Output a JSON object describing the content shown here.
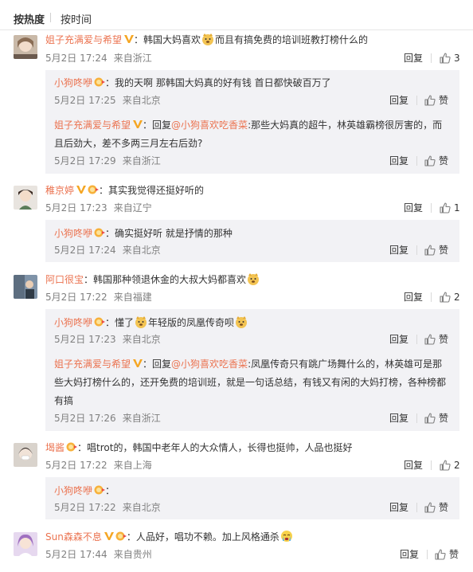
{
  "sort": {
    "hot": "按热度",
    "time": "按时间"
  },
  "actions": {
    "reply": "回复",
    "like": "赞"
  },
  "comments": [
    {
      "user": "姐子充满爱与希望",
      "text_a": "韩国大妈喜欢",
      "text_b": "而且有搞免费的培训班教打榜什么的",
      "date": "5月2日",
      "time": "17:24",
      "from": "来自浙江",
      "likes": "3",
      "replies": [
        {
          "user": "小狗咚咿",
          "text": "我的天啊  那韩国大妈真的好有钱  首日都快破百万了",
          "date": "5月2日",
          "time": "17:25",
          "from": "来自北京"
        },
        {
          "user": "姐子充满爱与希望",
          "prefix": "回复",
          "mention": "@小狗喜欢吃香菜",
          "text1": "那些大妈真的超牛，林英雄霸榜很厉害的，而",
          "text2": "且后劲大，差不多两三月左右后劲?",
          "date": "5月2日",
          "time": "17:29",
          "from": "来自浙江"
        }
      ]
    },
    {
      "user": "稚京婷",
      "text": "其实我觉得还挺好听的",
      "date": "5月2日",
      "time": "17:23",
      "from": "来自辽宁",
      "likes": "1",
      "replies": [
        {
          "user": "小狗咚咿",
          "text": "确实挺好听  就是抒情的那种",
          "date": "5月2日",
          "time": "17:24",
          "from": "来自北京"
        }
      ]
    },
    {
      "user": "阿口很宝",
      "text": "韩国那种领退休金的大叔大妈都喜欢",
      "date": "5月2日",
      "time": "17:22",
      "from": "来自福建",
      "likes": "2",
      "replies": [
        {
          "user": "小狗咚咿",
          "text_a": "懂了",
          "text_b": "年轻版的凤凰传奇呗",
          "date": "5月2日",
          "time": "17:23",
          "from": "来自北京"
        },
        {
          "user": "姐子充满爱与希望",
          "prefix": "回复",
          "mention": "@小狗喜欢吃香菜",
          "text1": "凤凰传奇只有跳广场舞什么的，林英雄可是那",
          "text2": "些大妈打榜什么的，还开免费的培训班，就是一句话总结，有钱又有闲的大妈打榜，各种榜都",
          "text3": "有搞",
          "date": "5月2日",
          "time": "17:26",
          "from": "来自浙江"
        }
      ]
    },
    {
      "user": "堨酱",
      "text": "唱trot的，韩国中老年人的大众情人，长得也挺帅，人品也挺好",
      "date": "5月2日",
      "time": "17:22",
      "from": "来自上海",
      "likes": "2",
      "replies": [
        {
          "user": "小狗咚咿",
          "text": "",
          "date": "5月2日",
          "time": "17:22",
          "from": "来自北京"
        }
      ]
    },
    {
      "user": "Sun森森不息",
      "text": "人品好，唱功不赖。加上风格通杀",
      "date": "5月2日",
      "time": "17:44",
      "from": "来自贵州",
      "likes": "赞"
    }
  ]
}
